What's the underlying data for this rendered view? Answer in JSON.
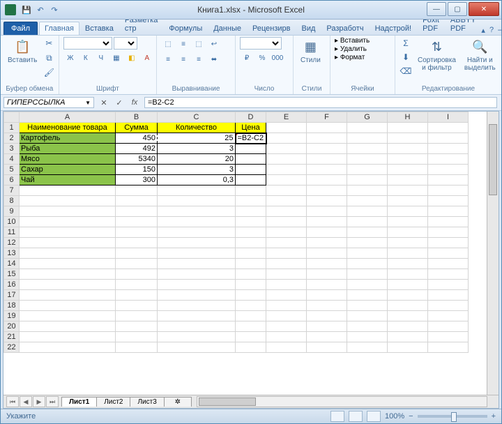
{
  "window": {
    "title": "Книга1.xlsx - Microsoft Excel"
  },
  "qat": {
    "save_tip": "💾",
    "undo_tip": "↶",
    "redo_tip": "↷"
  },
  "tabs": {
    "file": "Файл",
    "items": [
      "Главная",
      "Вставка",
      "Разметка стр",
      "Формулы",
      "Данные",
      "Рецензирв",
      "Вид",
      "Разработч",
      "Надстрой!",
      "Foxit PDF",
      "ABBYY PDF"
    ],
    "active": 0,
    "help": "?"
  },
  "ribbon": {
    "clipboard": {
      "paste": "Вставить",
      "label": "Буфер обмена"
    },
    "font": {
      "label": "Шрифт",
      "bold": "Ж",
      "italic": "К",
      "underline": "Ч"
    },
    "align": {
      "label": "Выравнивание"
    },
    "number": {
      "label": "Число",
      "sel": "%"
    },
    "styles": {
      "label": "Стили",
      "btn": "Стили"
    },
    "cells": {
      "label": "Ячейки",
      "insert": "Вставить",
      "delete": "Удалить",
      "format": "Формат"
    },
    "editing": {
      "label": "Редактирование",
      "sort": "Сортировка\nи фильтр",
      "find": "Найти и\nвыделить"
    }
  },
  "namebox": "ГИПЕРССЫЛКА",
  "fx": {
    "cancel": "✕",
    "accept": "✓",
    "fx": "fx"
  },
  "formula": "=B2-C2",
  "columns": [
    "A",
    "B",
    "C",
    "D",
    "E",
    "F",
    "G",
    "H",
    "I"
  ],
  "headers": {
    "a": "Наименование товара",
    "b": "Сумма",
    "c": "Количество",
    "d": "Цена"
  },
  "rows": [
    {
      "n": "Картофель",
      "s": "450",
      "q": "25"
    },
    {
      "n": "Рыба",
      "s": "492",
      "q": "3"
    },
    {
      "n": "Мясо",
      "s": "5340",
      "q": "20"
    },
    {
      "n": "Сахар",
      "s": "150",
      "q": "3"
    },
    {
      "n": "Чай",
      "s": "300",
      "q": "0,3"
    }
  ],
  "editing_value": "=B2-C2",
  "sheets": {
    "items": [
      "Лист1",
      "Лист2",
      "Лист3"
    ],
    "active": 0,
    "add": "+"
  },
  "status": {
    "mode": "Укажите",
    "zoom": "100%",
    "minus": "−",
    "plus": "+"
  }
}
